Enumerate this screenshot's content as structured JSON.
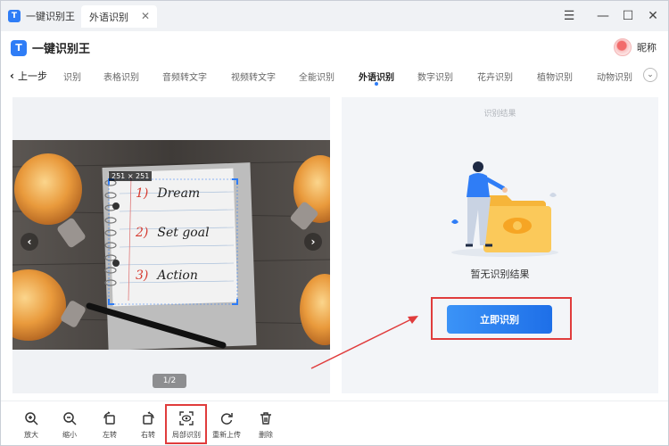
{
  "titlebar": {
    "app_name": "一键识别王",
    "doc_tab": "外语识别",
    "tab_close": "✕",
    "menu_icon": "☰",
    "minimize_icon": "—",
    "maximize_icon": "☐",
    "close_icon": "✕"
  },
  "header": {
    "app_name": "一键识别王",
    "user_name": "昵称"
  },
  "nav": {
    "back_label": "上一步",
    "items": [
      "识别",
      "表格识别",
      "音频转文字",
      "视频转文字",
      "全能识别",
      "外语识别",
      "数字识别",
      "花卉识别",
      "植物识别",
      "动物识别"
    ],
    "active": "外语识别"
  },
  "image_viewer": {
    "size_label": "251 × 251",
    "pager": "1/2",
    "prev": "‹",
    "next": "›",
    "note_lines": [
      {
        "num": "1)",
        "text": "Dream"
      },
      {
        "num": "2)",
        "text": "Set goal"
      },
      {
        "num": "3)",
        "text": "Action"
      }
    ]
  },
  "result": {
    "title": "识别结果",
    "empty_text": "暂无识别结果",
    "button_label": "立即识别"
  },
  "toolbar": {
    "zoom_in": "放大",
    "zoom_out": "缩小",
    "rotate_left": "左转",
    "rotate_right": "右转",
    "partial": "局部识别",
    "reupload": "重新上传",
    "delete": "删除"
  },
  "colors": {
    "accent": "#2f7df6",
    "highlight_red": "#e03c3c",
    "note_red": "#d63a2f"
  }
}
